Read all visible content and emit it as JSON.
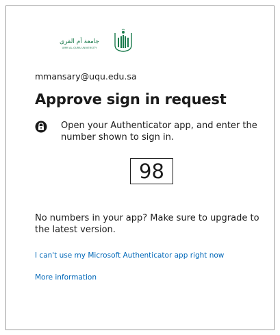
{
  "logo": {
    "arabic_text": "جامعة أم القرى",
    "english_text": "UMM AL-QURA UNIVERSITY"
  },
  "identity": "mmansary@uqu.edu.sa",
  "title": "Approve sign in request",
  "instruction": {
    "icon": "authenticator-lock-icon",
    "text": "Open your Authenticator app, and enter the number shown to sign in."
  },
  "number": "98",
  "no_numbers_text": "No numbers in your app? Make sure to upgrade to the latest version.",
  "links": {
    "cant_use": "I can't use my Microsoft Authenticator app right now",
    "more_info": "More information"
  },
  "colors": {
    "link": "#0067b8",
    "brand_green": "#1a7a4c",
    "text": "#1b1b1b",
    "border": "#9a9a9a"
  }
}
